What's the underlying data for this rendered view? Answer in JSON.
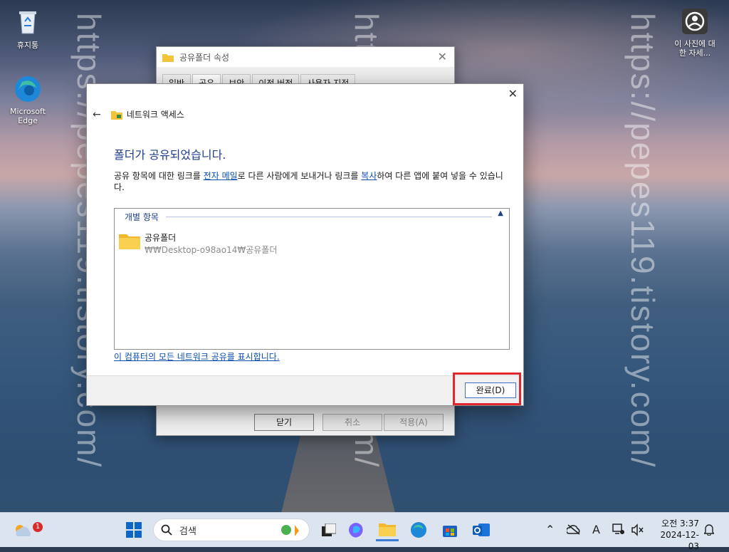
{
  "watermark": "https://pepes119.tistory.com/",
  "desktop": {
    "recycle_bin": "휴지통",
    "edge": "Microsoft Edge",
    "photo": "이 사진에 대한 자세..."
  },
  "back_window": {
    "title": "공유폴더 속성",
    "tabs": [
      "일반",
      "공유",
      "보안",
      "이전 버전",
      "사용자 지정"
    ],
    "buttons": {
      "close": "닫기",
      "cancel": "취소",
      "apply": "적용(A)"
    }
  },
  "dialog": {
    "title": "네트워크 액세스",
    "heading": "폴더가 공유되었습니다.",
    "desc_part1": "공유 항목에 대한 링크를 ",
    "desc_link_email": "전자 메일",
    "desc_part2": "로 다른 사람에게 보내거나 링크를 ",
    "desc_link_copy": "복사",
    "desc_part3": "하여 다른 앱에 붙여 넣을 수 있습니다.",
    "group_label": "개별 항목",
    "item_name": "공유폴더",
    "item_path": "₩₩Desktop-o98ao14₩공유폴더",
    "show_all_link": "이 컴퓨터의 모든 네트워크 공유를 표시합니다.",
    "done_button": "완료(D)"
  },
  "taskbar": {
    "weather_badge": "1",
    "search_label": "검색",
    "time": "오전 3:37",
    "date": "2024-12-03"
  }
}
